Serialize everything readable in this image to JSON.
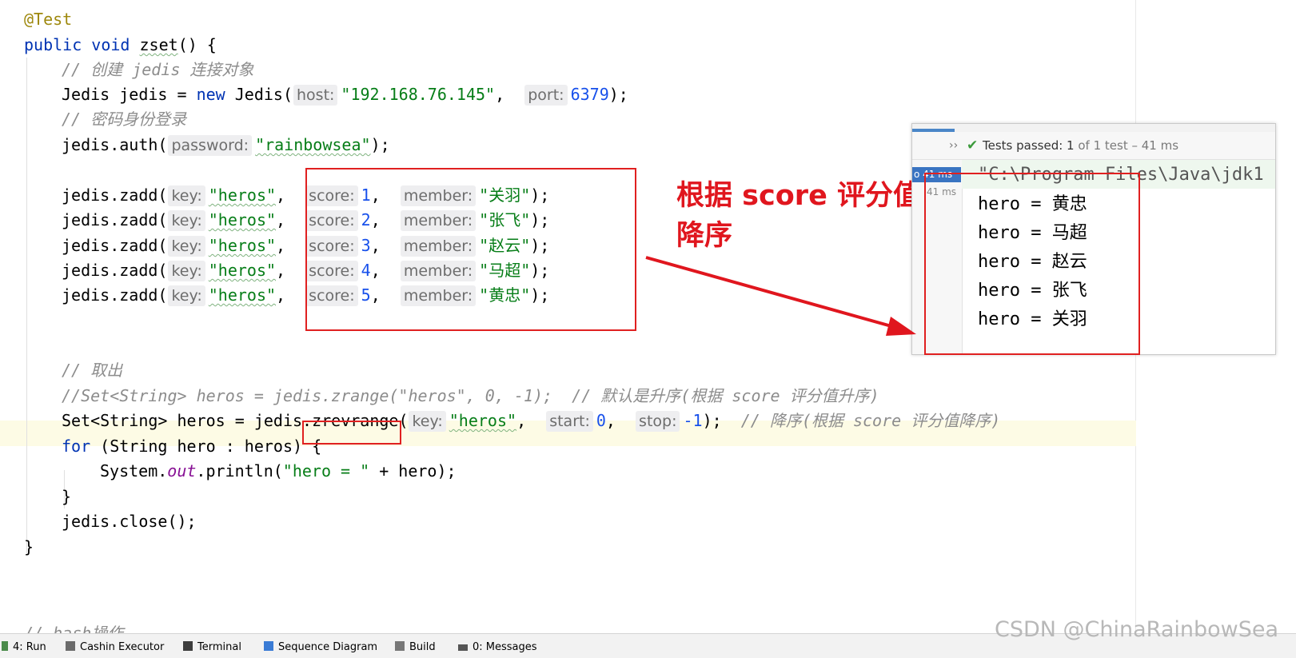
{
  "code": {
    "l0": "// hash操作",
    "annotation": "@Test",
    "kw_public": "public",
    "kw_void": "void",
    "method_name": "zset",
    "sig_tail": "() {",
    "c_create": "// 创建 jedis 连接对象",
    "jedis_decl": "Jedis jedis = ",
    "kw_new": "new",
    "jedis_ctor": " Jedis(",
    "hint_host": "host:",
    "host_value": "\"192.168.76.145\"",
    "comma": ",",
    "hint_port": "port:",
    "port_value": "6379",
    "end_paren": ");",
    "c_login": "// 密码身份登录",
    "auth_call": "jedis.auth(",
    "hint_password": "password:",
    "password_value": "\"rainbowsea\"",
    "zadd_call": "jedis.zadd(",
    "hint_key": "key:",
    "key_value": "\"heros\"",
    "hint_score": "score:",
    "hint_member": "member:",
    "zadds": [
      {
        "score": "1",
        "member": "\"关羽\""
      },
      {
        "score": "2",
        "member": "\"张飞\""
      },
      {
        "score": "3",
        "member": "\"赵云\""
      },
      {
        "score": "4",
        "member": "\"马超\""
      },
      {
        "score": "5",
        "member": "\"黄忠\""
      }
    ],
    "c_fetch": "// 取出",
    "c_zrange": "//Set<String> heros = jedis.zrange(\"heros\", 0, -1);  // 默认是升序(根据 score 评分值升序)",
    "set_decl": "Set<String> heros = jedis",
    "zrevrange": ".zrevrange(",
    "hint_start": "start:",
    "start_value": "0",
    "hint_stop": "stop:",
    "stop_value": "-1",
    "c_desc": "// 降序(根据 score 评分值降序)",
    "kw_for": "for",
    "for_tail": " (String hero : heros) {",
    "println_a": "System.",
    "println_out": "out",
    "println_b": ".println(",
    "println_str": "\"hero = \"",
    "println_c": " + hero);",
    "close_brace": "}",
    "close_call": "jedis.close();",
    "end_brace": "}",
    "c_hash": "// hash操作"
  },
  "annotation_text": {
    "line1": "根据 score 评分值",
    "line2": "降序"
  },
  "panel": {
    "status_label": "Tests passed: ",
    "status_count": "1",
    "status_rest": " of 1 test – 41 ms",
    "tree_selected": "o 41 ms",
    "tree_item": "41 ms",
    "output": [
      "\"C:\\Program Files\\Java\\jdk1",
      "hero = 黄忠",
      "hero = 马超",
      "hero = 赵云",
      "hero = 张飞",
      "hero = 关羽"
    ]
  },
  "bottom_tabs": [
    "4: Run",
    "Cashin Executor",
    "Terminal",
    "Sequence Diagram",
    "Build",
    "0: Messages"
  ],
  "watermark": "CSDN @ChinaRainbowSea",
  "colors": {
    "annotation_red": "#e0161e",
    "keyword_blue": "#0033b3",
    "string_green": "#067d17",
    "pass_green": "#3c9a3c"
  }
}
